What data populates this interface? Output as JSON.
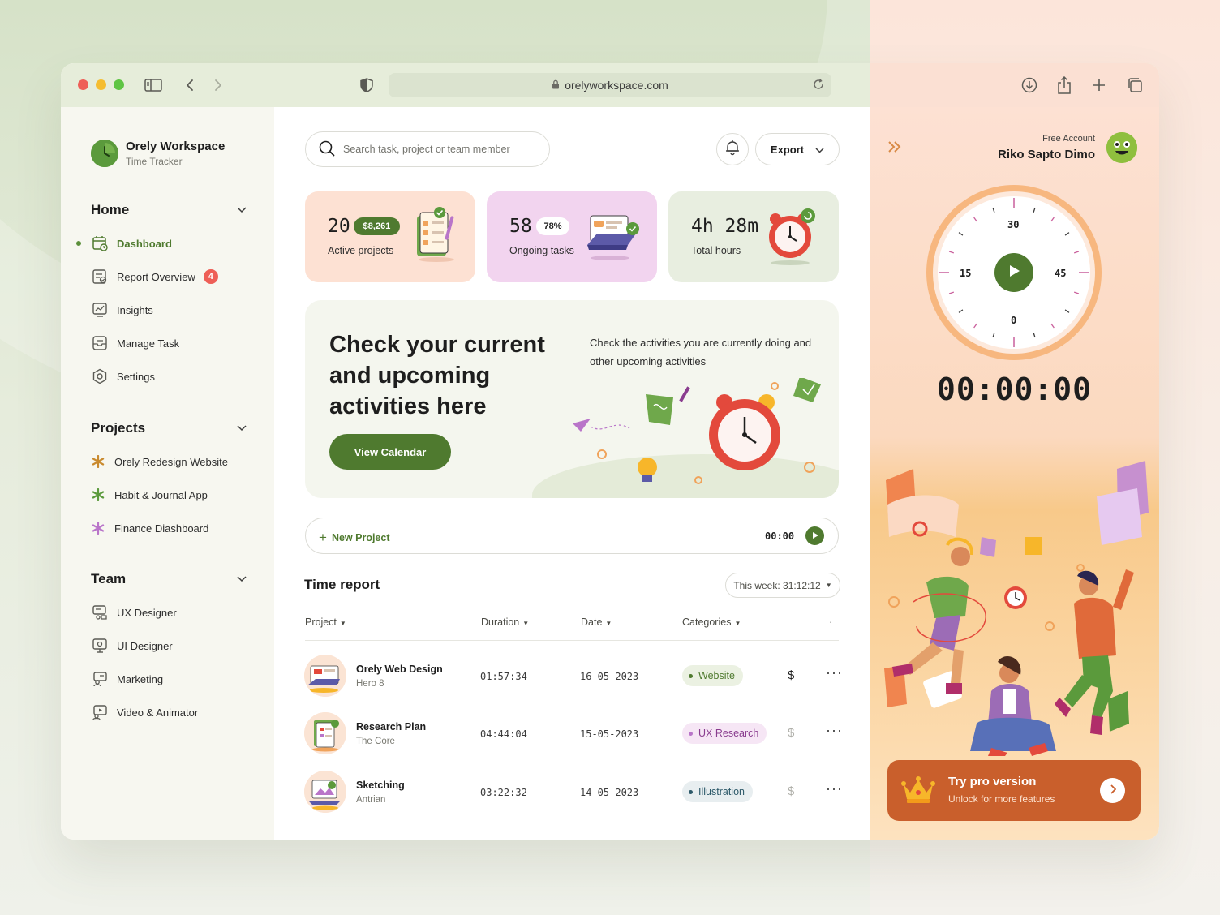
{
  "browser": {
    "url": "orelyworkspace.com"
  },
  "brand": {
    "title": "Orely Workspace",
    "subtitle": "Time Tracker"
  },
  "sidebar": {
    "home": {
      "title": "Home",
      "items": [
        {
          "label": "Dashboard",
          "icon": "calendar-clock-icon",
          "active": true
        },
        {
          "label": "Report Overview",
          "icon": "report-icon",
          "badge": "4"
        },
        {
          "label": "Insights",
          "icon": "chart-icon"
        },
        {
          "label": "Manage Task",
          "icon": "task-icon"
        },
        {
          "label": "Settings",
          "icon": "settings-icon"
        }
      ]
    },
    "projects": {
      "title": "Projects",
      "items": [
        {
          "label": "Orely Redesign Website",
          "color": "#c98a2e"
        },
        {
          "label": "Habit & Journal App",
          "color": "#5b9a3c"
        },
        {
          "label": "Finance Diashboard",
          "color": "#b975c9"
        }
      ]
    },
    "team": {
      "title": "Team",
      "items": [
        {
          "label": "UX Designer",
          "icon": "ux-designer-icon"
        },
        {
          "label": "UI Designer",
          "icon": "ui-designer-icon"
        },
        {
          "label": "Marketing",
          "icon": "marketing-icon"
        },
        {
          "label": "Video & Animator",
          "icon": "video-icon"
        }
      ]
    }
  },
  "header": {
    "search_placeholder": "Search task, project or team member",
    "export_label": "Export"
  },
  "stats": [
    {
      "number": "20",
      "pill": "$8,261",
      "label": "Active projects",
      "bg": "#fde1d3",
      "pill_bg": "#4f7a2f"
    },
    {
      "number": "58",
      "pill": "78%",
      "label": "Ongoing tasks",
      "bg": "#f2d4ef",
      "pill_bg": "#ffffff"
    },
    {
      "number": "4h 28m",
      "label": "Total hours",
      "bg": "#e8eee0"
    }
  ],
  "hero": {
    "title": "Check your current and upcoming activities here",
    "description": "Check the activities you are currently doing and other upcoming activities",
    "button": "View Calendar"
  },
  "new_project": {
    "label": "New Project",
    "timer": "00:00"
  },
  "time_report": {
    "title": "Time report",
    "week": "This week: 31:12:12",
    "columns": [
      "Project",
      "Duration",
      "Date",
      "Categories"
    ],
    "rows": [
      {
        "name": "Orely Web Design",
        "sub": "Hero 8",
        "duration": "01:57:34",
        "date": "16-05-2023",
        "category": "Website",
        "cat_bg": "#ebf1e2",
        "cat_color": "#4f7a2f",
        "dollar_color": "#1e1e1e"
      },
      {
        "name": "Research Plan",
        "sub": "The Core",
        "duration": "04:44:04",
        "date": "15-05-2023",
        "category": "UX Research",
        "cat_bg": "#f6e6f5",
        "cat_color": "#8a3d8f",
        "dollar_color": "#b0b0aa"
      },
      {
        "name": "Sketching",
        "sub": "Antrian",
        "duration": "03:22:32",
        "date": "14-05-2023",
        "category": "Illustration",
        "cat_bg": "#e8eef0",
        "cat_color": "#2e5a6a",
        "dollar_color": "#b0b0aa"
      }
    ]
  },
  "right_panel": {
    "account_type": "Free Account",
    "user_name": "Riko Sapto Dimo",
    "clock_numbers": {
      "top": "30",
      "left": "15",
      "right": "45",
      "bottom": "0"
    },
    "timer": "00:00:00",
    "promo": {
      "title": "Try pro version",
      "subtitle": "Unlock for more features"
    }
  }
}
